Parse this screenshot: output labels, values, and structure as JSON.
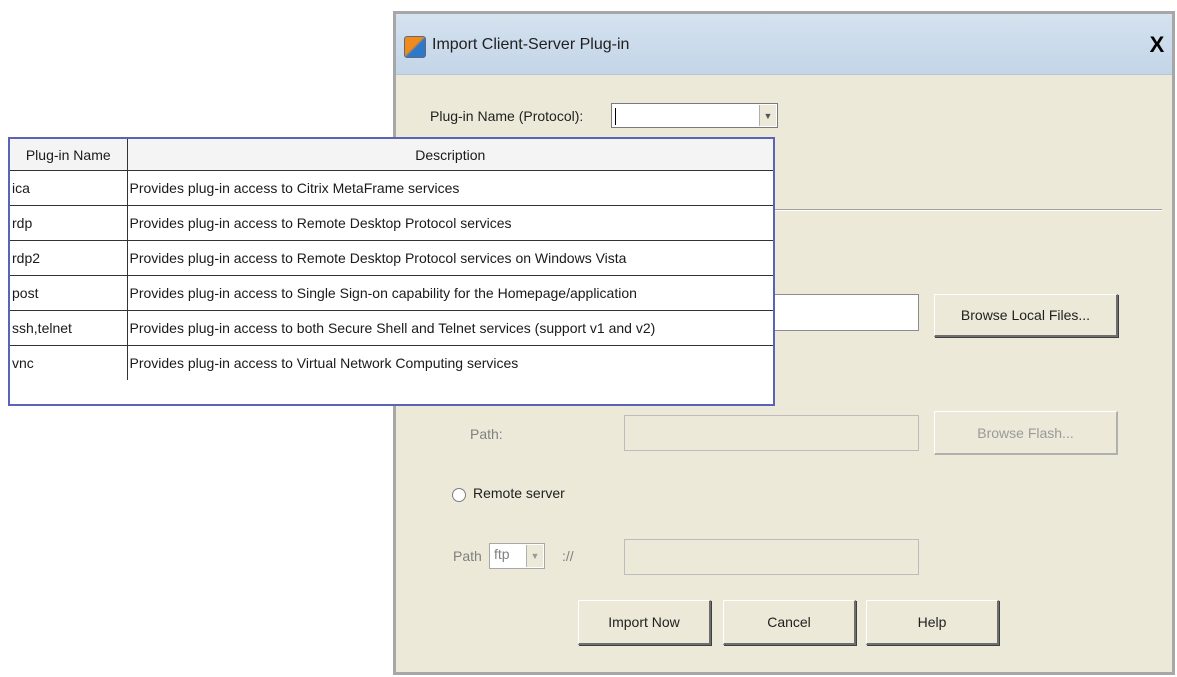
{
  "dialog": {
    "title": "Import Client-Server Plug-in",
    "close_label": "X",
    "plugin_name_label": "Plug-in Name (Protocol):",
    "plugin_name_value": "",
    "browse_local_label": "Browse Local Files...",
    "flash_path_label": "Path:",
    "browse_flash_label": "Browse Flash...",
    "remote_server_label": "Remote server",
    "remote_path_label": "Path",
    "protocol_value": "ftp",
    "protocol_separator": "://",
    "import_label": "Import Now",
    "cancel_label": "Cancel",
    "help_label": "Help"
  },
  "plugin_table": {
    "headers": [
      "Plug-in Name",
      "Description"
    ],
    "rows": [
      {
        "name": "ica",
        "description": "Provides plug-in access to Citrix MetaFrame services"
      },
      {
        "name": "rdp",
        "description": "Provides plug-in access to Remote Desktop Protocol services"
      },
      {
        "name": "rdp2",
        "description": "Provides plug-in access to Remote Desktop Protocol services on Windows Vista"
      },
      {
        "name": "post",
        "description": "Provides plug-in access to Single Sign-on capability for the Homepage/application"
      },
      {
        "name": "ssh,telnet",
        "description": "Provides plug-in access to both Secure Shell and Telnet services (support v1 and v2)"
      },
      {
        "name": "vnc",
        "description": "Provides plug-in access to Virtual Network Computing services"
      }
    ]
  }
}
